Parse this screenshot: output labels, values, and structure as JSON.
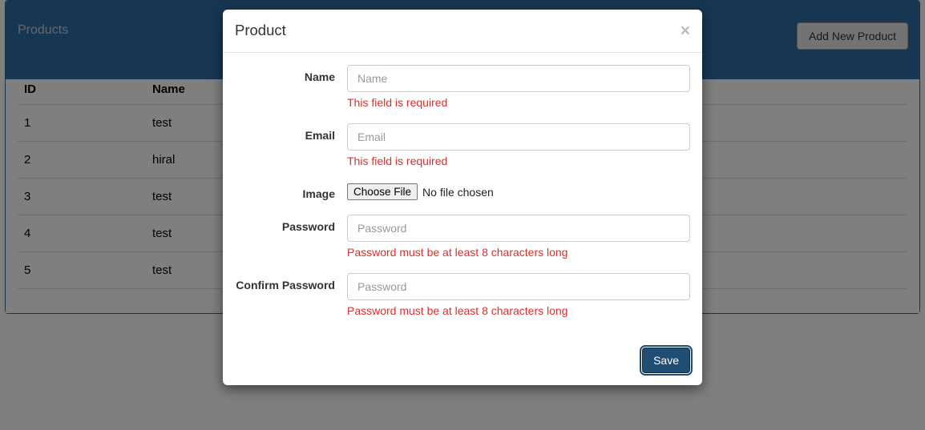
{
  "panel": {
    "title": "Products",
    "add_button": "Add New Product"
  },
  "table": {
    "headers": {
      "id": "ID",
      "name": "Name"
    },
    "rows": [
      {
        "id": "1",
        "name": "test"
      },
      {
        "id": "2",
        "name": "hiral"
      },
      {
        "id": "3",
        "name": "test"
      },
      {
        "id": "4",
        "name": "test"
      },
      {
        "id": "5",
        "name": "test"
      }
    ]
  },
  "modal": {
    "title": "Product",
    "close": "×",
    "fields": {
      "name": {
        "label": "Name",
        "placeholder": "Name",
        "error": "This field is required"
      },
      "email": {
        "label": "Email",
        "placeholder": "Email",
        "error": "This field is required"
      },
      "image": {
        "label": "Image",
        "button": "Choose File",
        "text": "No file chosen"
      },
      "password": {
        "label": "Password",
        "placeholder": "Password",
        "error": "Password must be at least 8 characters long"
      },
      "confirm": {
        "label": "Confirm Password",
        "placeholder": "Password",
        "error": "Password must be at least 8 characters long"
      }
    },
    "save": "Save"
  }
}
